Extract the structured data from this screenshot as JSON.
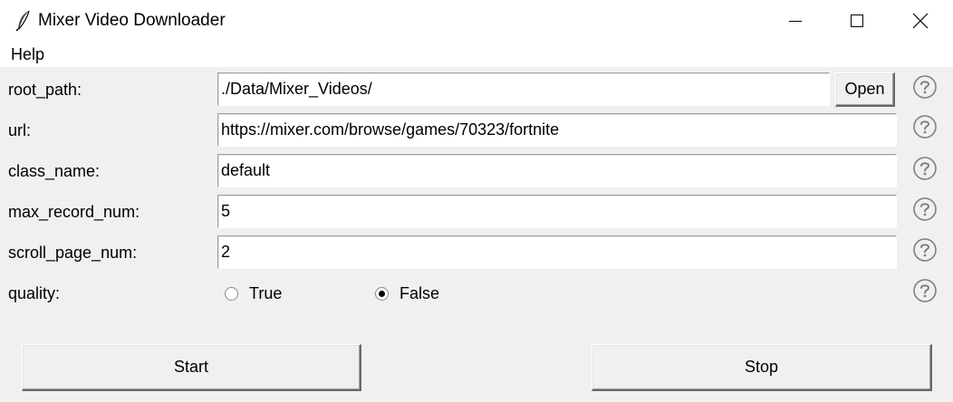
{
  "window": {
    "title": "Mixer Video Downloader",
    "icon": "feather-icon"
  },
  "menu": {
    "items": [
      {
        "label": "Help"
      }
    ]
  },
  "form": {
    "root_path": {
      "label": "root_path:",
      "value": "./Data/Mixer_Videos/",
      "button": "Open"
    },
    "url": {
      "label": "url:",
      "value": "https://mixer.com/browse/games/70323/fortnite"
    },
    "class_name": {
      "label": "class_name:",
      "value": "default"
    },
    "max_record_num": {
      "label": "max_record_num:",
      "value": "5"
    },
    "scroll_page_num": {
      "label": "scroll_page_num:",
      "value": "2"
    },
    "quality": {
      "label": "quality:",
      "options": [
        {
          "label": "True",
          "checked": false
        },
        {
          "label": "False",
          "checked": true
        }
      ]
    }
  },
  "buttons": {
    "start": "Start",
    "stop": "Stop"
  }
}
